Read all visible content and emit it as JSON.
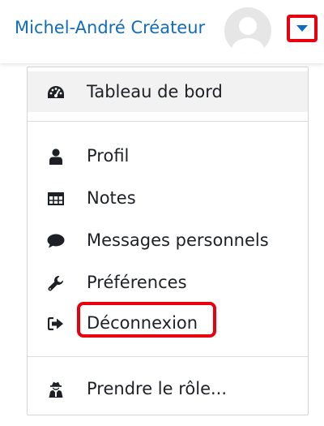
{
  "header": {
    "user_name": "Michel-André Créateur",
    "avatar_icon": "user-avatar-icon",
    "menu_toggle_icon": "caret-down-icon",
    "accent_color": "#0f6cbf",
    "highlight_color": "#e8000f"
  },
  "menu": {
    "items": [
      {
        "label": "Tableau de bord",
        "icon": "dashboard-icon"
      },
      {
        "label": "Profil",
        "icon": "user-icon"
      },
      {
        "label": "Notes",
        "icon": "table-icon"
      },
      {
        "label": "Messages personnels",
        "icon": "comment-icon"
      },
      {
        "label": "Préférences",
        "icon": "wrench-icon"
      },
      {
        "label": "Déconnexion",
        "icon": "sign-out-icon"
      },
      {
        "label": "Prendre le rôle...",
        "icon": "user-secret-icon"
      }
    ]
  }
}
